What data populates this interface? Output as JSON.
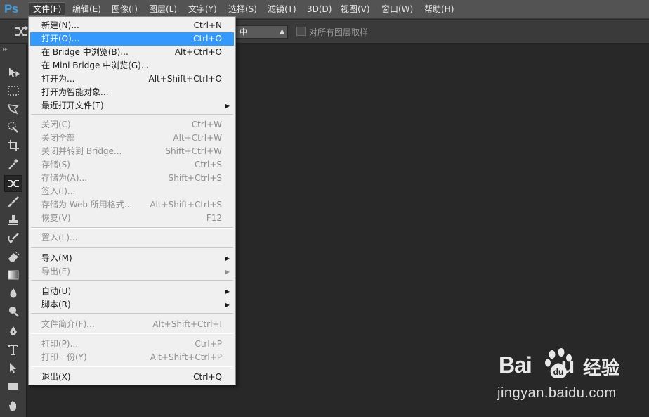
{
  "app": {
    "logo": "Ps"
  },
  "menubar": {
    "items": [
      {
        "label": "文件(F)"
      },
      {
        "label": "编辑(E)"
      },
      {
        "label": "图像(I)"
      },
      {
        "label": "图层(L)"
      },
      {
        "label": "文字(Y)"
      },
      {
        "label": "选择(S)"
      },
      {
        "label": "滤镜(T)"
      },
      {
        "label": "3D(D)"
      },
      {
        "label": "视图(V)"
      },
      {
        "label": "窗口(W)"
      },
      {
        "label": "帮助(H)"
      }
    ]
  },
  "options": {
    "mode_value": "中",
    "sample_all_layers_label": "对所有图层取样",
    "sample_all_layers_checked": false
  },
  "file_menu": {
    "items": [
      {
        "label": "新建(N)...",
        "shortcut": "Ctrl+N"
      },
      {
        "label": "打开(O)...",
        "shortcut": "Ctrl+O"
      },
      {
        "label": "在 Bridge 中浏览(B)...",
        "shortcut": "Alt+Ctrl+O"
      },
      {
        "label": "在 Mini Bridge 中浏览(G)...",
        "shortcut": ""
      },
      {
        "label": "打开为...",
        "shortcut": "Alt+Shift+Ctrl+O"
      },
      {
        "label": "打开为智能对象...",
        "shortcut": ""
      },
      {
        "label": "最近打开文件(T)",
        "shortcut": ""
      },
      {
        "label": "关闭(C)",
        "shortcut": "Ctrl+W"
      },
      {
        "label": "关闭全部",
        "shortcut": "Alt+Ctrl+W"
      },
      {
        "label": "关闭并转到 Bridge...",
        "shortcut": "Shift+Ctrl+W"
      },
      {
        "label": "存储(S)",
        "shortcut": "Ctrl+S"
      },
      {
        "label": "存储为(A)...",
        "shortcut": "Shift+Ctrl+S"
      },
      {
        "label": "签入(I)...",
        "shortcut": ""
      },
      {
        "label": "存储为 Web 所用格式...",
        "shortcut": "Alt+Shift+Ctrl+S"
      },
      {
        "label": "恢复(V)",
        "shortcut": "F12"
      },
      {
        "label": "置入(L)...",
        "shortcut": ""
      },
      {
        "label": "导入(M)",
        "shortcut": ""
      },
      {
        "label": "导出(E)",
        "shortcut": ""
      },
      {
        "label": "自动(U)",
        "shortcut": ""
      },
      {
        "label": "脚本(R)",
        "shortcut": ""
      },
      {
        "label": "文件简介(F)...",
        "shortcut": "Alt+Shift+Ctrl+I"
      },
      {
        "label": "打印(P)...",
        "shortcut": "Ctrl+P"
      },
      {
        "label": "打印一份(Y)",
        "shortcut": "Alt+Shift+Ctrl+P"
      },
      {
        "label": "退出(X)",
        "shortcut": "Ctrl+Q"
      }
    ]
  },
  "watermark": {
    "brand": "Bai du",
    "brand_left": "Bai",
    "brand_right": "u",
    "product": "经验",
    "url": "jingyan.baidu.com"
  },
  "colors": {
    "highlight": "#3399ff",
    "menubar_bg": "#535353",
    "workspace_bg": "#282828",
    "menu_bg": "#f0f0f0",
    "ps_logo": "#3c9ee6"
  }
}
